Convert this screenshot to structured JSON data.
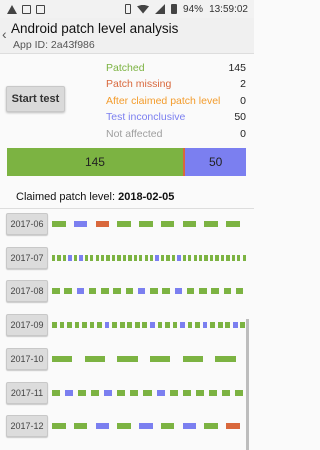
{
  "status_bar": {
    "battery": "94%",
    "time": "13:59:02"
  },
  "header": {
    "title": "Android patch level analysis",
    "subtitle": "App ID: 2a43f986"
  },
  "start_button": "Start test",
  "stats": [
    {
      "label": "Patched",
      "value": "145",
      "color": "#7cb342"
    },
    {
      "label": "Patch missing",
      "value": "2",
      "color": "#d9683c"
    },
    {
      "label": "After claimed patch level",
      "value": "0",
      "color": "#f39c2c"
    },
    {
      "label": "Test inconclusive",
      "value": "50",
      "color": "#7b7ff0"
    },
    {
      "label": "Not affected",
      "value": "0",
      "color": "#9e9e9e"
    }
  ],
  "summary_bar": [
    {
      "name": "patched",
      "value": 145,
      "label": "145",
      "color": "#7cb342"
    },
    {
      "name": "missing",
      "value": 2,
      "label": "",
      "color": "#d9683c"
    },
    {
      "name": "inconclusive",
      "value": 50,
      "label": "50",
      "color": "#7b7ff0"
    }
  ],
  "claimed": {
    "label": "Claimed patch level:",
    "value": "2018-02-05"
  },
  "months": [
    {
      "label": "2017-06",
      "tests": [
        "g",
        "b",
        "r",
        "g",
        "g",
        "g",
        "g",
        "g",
        "g"
      ]
    },
    {
      "label": "2017-07",
      "tests": [
        "g",
        "g",
        "g",
        "b",
        "g",
        "b",
        "g",
        "g",
        "g",
        "g",
        "g",
        "g",
        "g",
        "g",
        "g",
        "g",
        "g",
        "g",
        "g",
        "b",
        "g",
        "g",
        "g",
        "b",
        "g",
        "g",
        "g",
        "g",
        "g",
        "g",
        "g",
        "g",
        "g",
        "g",
        "g",
        "g"
      ]
    },
    {
      "label": "2017-08",
      "tests": [
        "g",
        "g",
        "b",
        "g",
        "g",
        "g",
        "g",
        "b",
        "g",
        "g",
        "b",
        "g",
        "g",
        "g",
        "g",
        "g"
      ]
    },
    {
      "label": "2017-09",
      "tests": [
        "g",
        "g",
        "g",
        "g",
        "g",
        "g",
        "g",
        "b",
        "g",
        "g",
        "g",
        "g",
        "g",
        "b",
        "g",
        "g",
        "g",
        "b",
        "g",
        "g",
        "b",
        "g",
        "g",
        "g",
        "b",
        "g"
      ]
    },
    {
      "label": "2017-10",
      "tests": [
        "g",
        "g",
        "g",
        "g",
        "g",
        "g"
      ]
    },
    {
      "label": "2017-11",
      "tests": [
        "g",
        "b",
        "g",
        "g",
        "b",
        "g",
        "g",
        "g",
        "b",
        "g",
        "g",
        "g",
        "g",
        "g",
        "g"
      ]
    },
    {
      "label": "2017-12",
      "tests": [
        "g",
        "g",
        "b",
        "g",
        "b",
        "g",
        "b",
        "g",
        "r"
      ]
    }
  ]
}
